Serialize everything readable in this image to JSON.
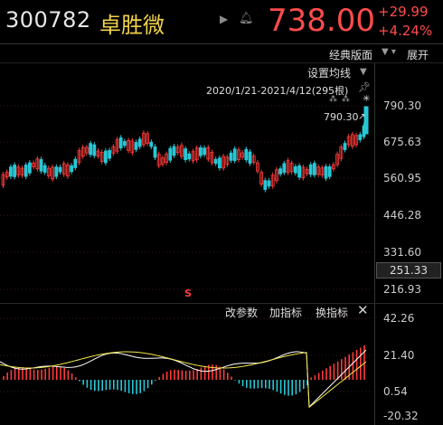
{
  "header": {
    "code": "300782",
    "name": "卓胜微",
    "price": "738.00",
    "change": "+29.99",
    "change_pct": "+4.24%"
  },
  "toolbar": {
    "classic_label": "经典版面",
    "expand_label": "展开",
    "ma_label": "设置均线"
  },
  "range_label": "2020/1/21-2021/4/12(295根)",
  "y_axis": {
    "ticks": [
      "790.30",
      "675.63",
      "560.95",
      "446.28",
      "331.60",
      "216.93"
    ],
    "last": "251.33"
  },
  "sub_panel": {
    "param_label": "改参数",
    "add_label": "加指标",
    "switch_label": "换指标",
    "ticks": [
      "42.26",
      "21.40",
      "0.54",
      "-20.32"
    ]
  },
  "max_label": "790.30",
  "event_marker": "S",
  "event_icons": "⁂ ⁂",
  "colors": {
    "up": "#ff3b3b",
    "down": "#27c7d6",
    "dif": "#ffffff",
    "dea": "#f2e84b"
  },
  "chart_data": {
    "type": "candlestick+macd",
    "price_range": [
      216.93,
      790.3
    ],
    "macd_range": [
      -20.32,
      42.26
    ]
  }
}
